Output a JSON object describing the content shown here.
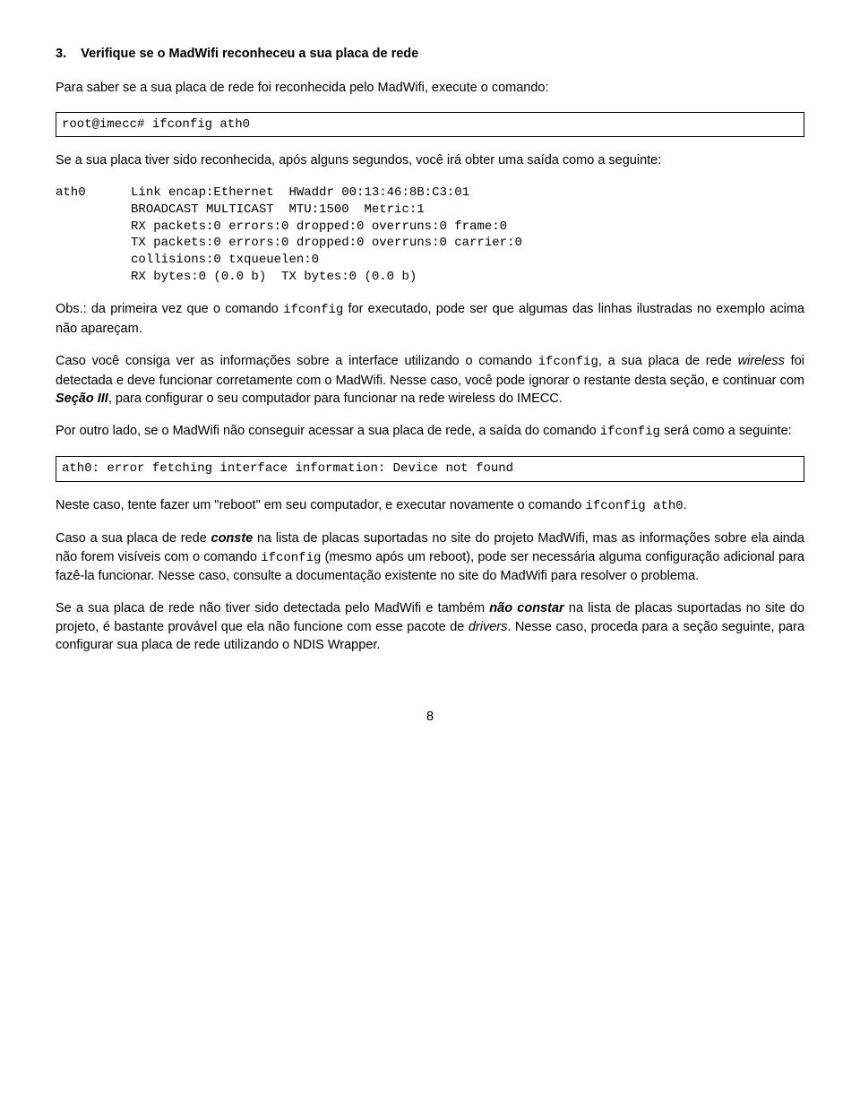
{
  "section": {
    "number": "3.",
    "title": "Verifique se o MadWifi reconheceu a sua placa de rede"
  },
  "p1_pre": "Para saber se a sua placa de rede foi reconhecida pelo MadWifi, execute o comando:",
  "code1": "root@imecc# ifconfig ath0",
  "p2_pre": "Se a sua placa tiver sido reconhecida, após alguns segundos, você irá obter uma saída como a seguinte:",
  "code2": "ath0      Link encap:Ethernet  HWaddr 00:13:46:8B:C3:01\n          BROADCAST MULTICAST  MTU:1500  Metric:1\n          RX packets:0 errors:0 dropped:0 overruns:0 frame:0\n          TX packets:0 errors:0 dropped:0 overruns:0 carrier:0\n          collisions:0 txqueuelen:0\n          RX bytes:0 (0.0 b)  TX bytes:0 (0.0 b)",
  "obs": {
    "pre": "Obs.: da primeira vez que o comando ",
    "code": "ifconfig",
    "post": " for executado, pode ser que algumas das linhas ilustradas no exemplo acima não apareçam."
  },
  "p4": {
    "s1_pre": "Caso você consiga ver as informações sobre a interface utilizando o comando ",
    "s1_code": "ifconfig",
    "s1_post1": ", a sua placa de rede ",
    "s1_em": "wireless",
    "s1_post2": " foi detectada e deve funcionar corretamente com o MadWifi.  Nesse caso, você pode ignorar o restante desta seção, e continuar com ",
    "s1_strong": "Seção III",
    "s1_post3": ", para configurar o seu computador para funcionar na rede wireless do IMECC."
  },
  "p5": {
    "pre": "Por outro lado, se o MadWifi não conseguir acessar a sua placa de rede, a saída do comando ",
    "code": "ifconfig",
    "post": " será como a seguinte:"
  },
  "code3": "ath0: error fetching interface information: Device not found",
  "p6": {
    "pre": "Neste caso, tente fazer um \"reboot\" em seu computador, e executar novamente o comando ",
    "code": "ifconfig ath0",
    "post": "."
  },
  "p7": {
    "s1_pre": "Caso a sua placa de rede ",
    "s1_strong": "conste",
    "s1_post": " na lista de placas suportadas no site do projeto MadWifi, mas as informações sobre ela ainda não forem visíveis com o comando ",
    "s1_code": "ifconfig",
    "s1_post2": " (mesmo após um reboot), pode ser necessária alguma configuração adicional para fazê-la funcionar.  Nesse caso, consulte a documentação existente no site do MadWifi para resolver o problema."
  },
  "p8": {
    "s1_pre": "Se a sua placa de rede não tiver sido detectada pelo MadWifi e também ",
    "s1_strong": "não constar",
    "s1_post": " na lista de placas suportadas no site do projeto, é bastante provável que ela não funcione com esse pacote de ",
    "s1_em": "drivers",
    "s1_post2": ".  Nesse caso, proceda para a seção seguinte, para configurar sua placa de rede utilizando o NDIS Wrapper."
  },
  "page_number": "8"
}
